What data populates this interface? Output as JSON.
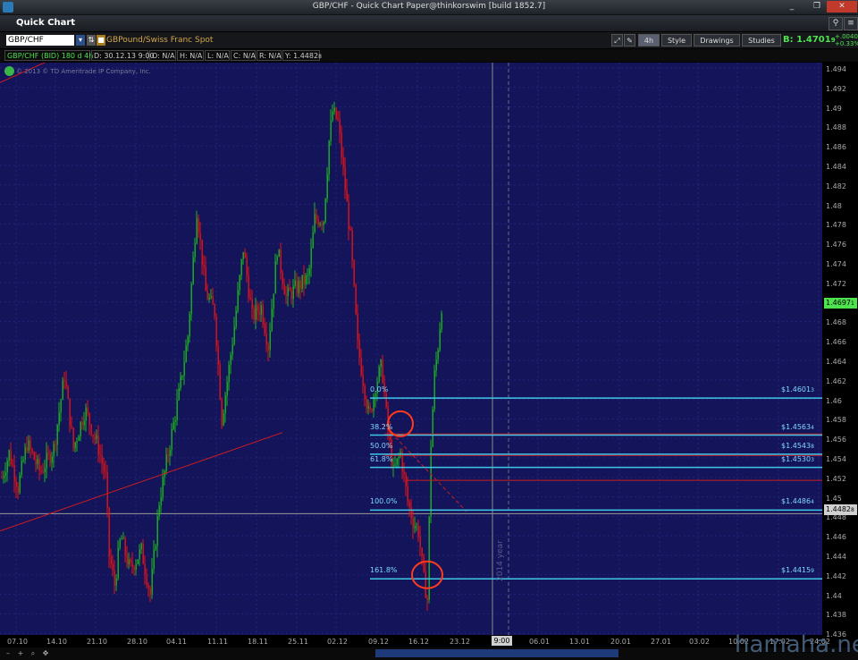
{
  "window": {
    "title": "GBP/CHF - Quick Chart Paper@thinkorswim [build 1852.7]"
  },
  "header": {
    "title": "Quick Chart"
  },
  "toolbar": {
    "symbol": "GBP/CHF",
    "description": "GBPound/Swiss Franc Spot",
    "timeframe": "4h",
    "style_label": "Style",
    "drawings_label": "Drawings",
    "studies_label": "Studies",
    "bid_label": "B: 1.4701",
    "bid_suffix": "9",
    "change": "+.00402",
    "change_pct": "+0.33%"
  },
  "infobar": {
    "study": "GBP/CHF (BID) 180 d 4h",
    "date": "D: 30.12.13 9:00",
    "open": "O: N/A",
    "high": "H: N/A",
    "low": "L: N/A",
    "close": "C: N/A",
    "range": "R: N/A",
    "y": "Y: 1.4482",
    "y_suffix": "8"
  },
  "chart": {
    "copyright": "© 2013 © TD Ameritrade IP Company, Inc.",
    "year_marker": "2014 year",
    "watermark": "hamaha.net"
  },
  "yaxis": {
    "labels": [
      "1.494",
      "1.492",
      "1.49",
      "1.488",
      "1.486",
      "1.484",
      "1.482",
      "1.48",
      "1.478",
      "1.476",
      "1.474",
      "1.472",
      "1.47",
      "1.468",
      "1.466",
      "1.464",
      "1.462",
      "1.46",
      "1.458",
      "1.456",
      "1.454",
      "1.452",
      "1.45",
      "1.448",
      "1.446",
      "1.444",
      "1.442",
      "1.44",
      "1.438",
      "1.436"
    ],
    "last_price": "1.4697",
    "last_suffix": "1",
    "cursor_price": "1.4482",
    "cursor_suffix": "8"
  },
  "xaxis": {
    "labels": [
      "07.10",
      "14.10",
      "21.10",
      "28.10",
      "04.11",
      "11.11",
      "18.11",
      "25.11",
      "02.12",
      "09.12",
      "16.12",
      "23.12",
      "06.01",
      "13.01",
      "20.01",
      "27.01",
      "03.02",
      "10.02",
      "17.02",
      "24.02"
    ],
    "cursor_time": "9:00"
  },
  "fibonacci": [
    {
      "pct": "0.0%",
      "price": "$1.4601",
      "suffix": "3"
    },
    {
      "pct": "38.2%",
      "price": "$1.4563",
      "suffix": "4"
    },
    {
      "pct": "50.0%",
      "price": "$1.4543",
      "suffix": "8"
    },
    {
      "pct": "61.8%",
      "price": "$1.4530",
      "suffix": "3"
    },
    {
      "pct": "100.0%",
      "price": "$1.4486",
      "suffix": "4"
    },
    {
      "pct": "161.8%",
      "price": "$1.4415",
      "suffix": "9"
    }
  ],
  "colors": {
    "chart_bg": "#14145a",
    "bull": "#17b917",
    "bear": "#e81212",
    "fib": "#3fc7e6",
    "trend": "#d11c1c",
    "price_green": "#4fe24f",
    "ellipse": "#ff3b1f"
  }
}
